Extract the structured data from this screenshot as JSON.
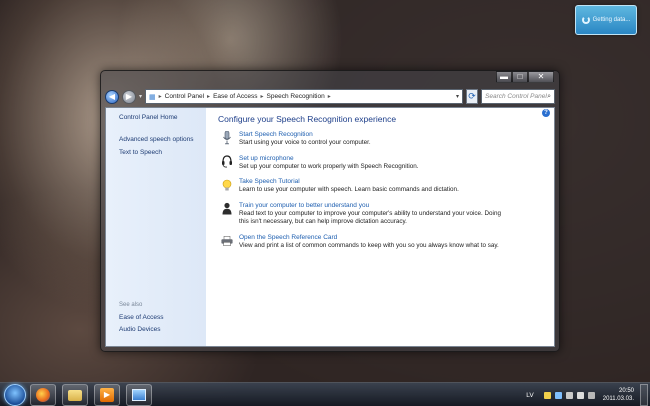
{
  "gadget": {
    "text": "Getting data..."
  },
  "window": {
    "caption_buttons": {
      "minimize": "▬",
      "maximize": "□",
      "close": "✕"
    },
    "address_bar": {
      "segments": [
        "Control Panel",
        "Ease of Access",
        "Speech Recognition"
      ],
      "separator": "▸"
    },
    "search": {
      "placeholder": "Search Control Panel"
    },
    "help_icon": "?"
  },
  "sidebar": {
    "home": "Control Panel Home",
    "links": [
      "Advanced speech options",
      "Text to Speech"
    ],
    "see_also_heading": "See also",
    "see_also": [
      "Ease of Access",
      "Audio Devices"
    ]
  },
  "main": {
    "title": "Configure your Speech Recognition experience",
    "items": [
      {
        "icon": "microphone-icon",
        "title": "Start Speech Recognition",
        "desc": "Start using your voice to control your computer."
      },
      {
        "icon": "headset-icon",
        "title": "Set up microphone",
        "desc": "Set up your computer to work properly with Speech Recognition."
      },
      {
        "icon": "lightbulb-icon",
        "title": "Take Speech Tutorial",
        "desc": "Learn to use your computer with speech.  Learn basic commands and dictation."
      },
      {
        "icon": "person-icon",
        "title": "Train your computer to better understand you",
        "desc": "Read text to your computer to improve your computer's ability to understand your voice. Doing this isn't necessary, but can help improve dictation accuracy."
      },
      {
        "icon": "printer-icon",
        "title": "Open the Speech Reference Card",
        "desc": "View and print a list of common commands to keep with you so you always know what to say."
      }
    ]
  },
  "taskbar": {
    "language": "LV",
    "time": "20:50",
    "date": "2011.03.03."
  }
}
